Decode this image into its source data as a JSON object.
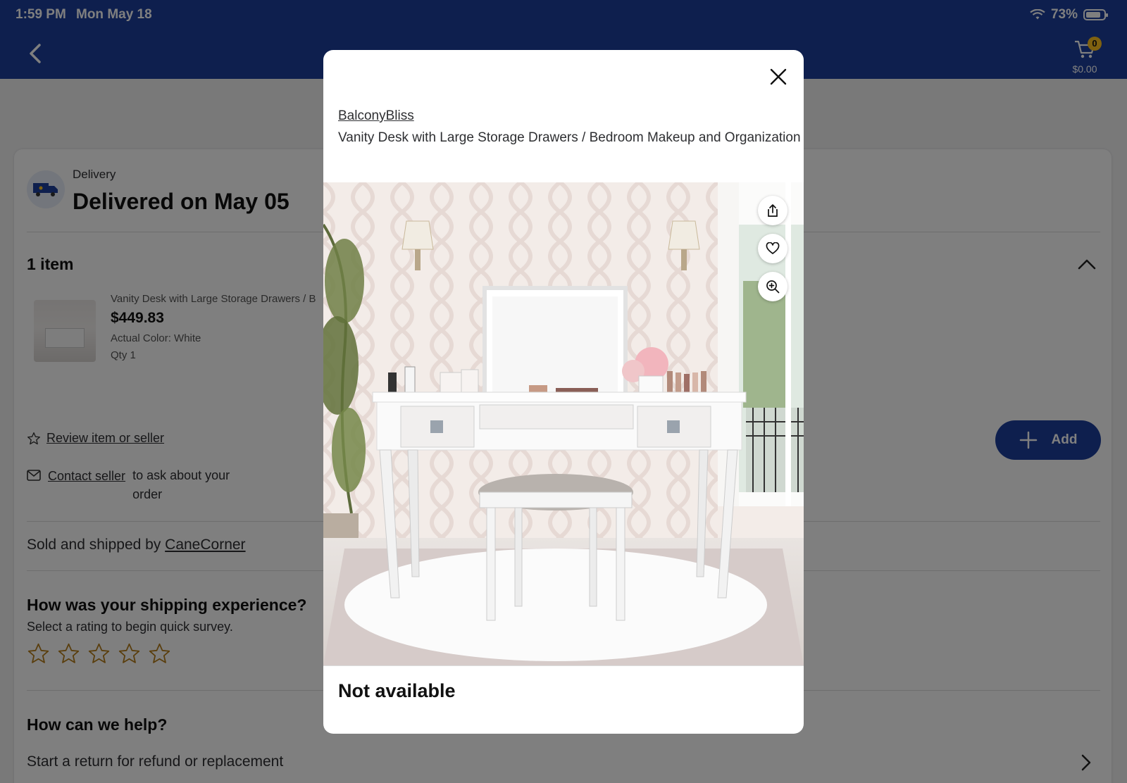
{
  "status_bar": {
    "time": "1:59 PM",
    "date": "Mon May 18",
    "battery": "73%"
  },
  "navbar": {
    "cart_count": "0",
    "cart_total": "$0.00"
  },
  "delivery": {
    "label": "Delivery",
    "title": "Delivered on May 05"
  },
  "items": {
    "count_label": "1 item",
    "product": {
      "name": "Vanity Desk with Large Storage Drawers / B",
      "price": "$449.83",
      "color": "Actual Color: White",
      "qty": "Qty 1"
    }
  },
  "actions": {
    "review": "Review item or seller",
    "contact_link": "Contact seller",
    "contact_rest": "to ask about your order",
    "add": "Add"
  },
  "sold_by": {
    "prefix": "Sold and shipped by",
    "seller": "CaneCorner"
  },
  "shipping_survey": {
    "question": "How was your shipping experience?",
    "subtitle": "Select a rating to begin quick survey.",
    "rating": 0,
    "max_rating": 5
  },
  "help": {
    "question": "How can we help?",
    "return_item": "Start a return for refund or replacement"
  },
  "modal": {
    "brand": "BalconyBliss",
    "title": "Vanity Desk with Large Storage Drawers / Bedroom Makeup and Organization",
    "availability": "Not available",
    "icons": [
      "share-icon",
      "heart-icon",
      "zoom-in-icon",
      "close-icon"
    ]
  },
  "colors": {
    "primary": "#1c3e9c",
    "accent": "#ffc220",
    "star_outline": "#b47c1a"
  }
}
